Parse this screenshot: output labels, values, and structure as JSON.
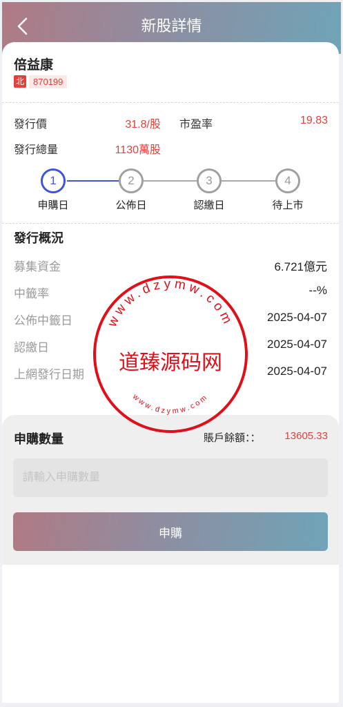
{
  "header": {
    "title": "新股詳情"
  },
  "stock": {
    "name": "倍益康",
    "market_badge": "北",
    "code": "870199"
  },
  "issue": {
    "price_label": "發行價",
    "price_value": "31.8/股",
    "pe_label": "市盈率",
    "pe_value": "19.83",
    "volume_label": "發行總量",
    "volume_value": "1130萬股"
  },
  "steps": [
    {
      "number": "1",
      "label": "申購日",
      "active": true
    },
    {
      "number": "2",
      "label": "公佈日",
      "active": false
    },
    {
      "number": "3",
      "label": "認繳日",
      "active": false
    },
    {
      "number": "4",
      "label": "待上市",
      "active": false
    }
  ],
  "overview": {
    "title": "發行概況",
    "rows": [
      {
        "label": "募集資金",
        "value": "6.721億元"
      },
      {
        "label": "中籤率",
        "value": "--%"
      },
      {
        "label": "公佈中籤日",
        "value": "2025-04-07"
      },
      {
        "label": "認繳日",
        "value": "2025-04-07"
      },
      {
        "label": "上網發行日期",
        "value": "2025-04-07"
      }
    ]
  },
  "subscribe": {
    "title": "申購數量",
    "balance_label": "賬戶餘額：：",
    "balance_value": "13605.33",
    "input_value": "",
    "input_placeholder": "請輸入申購數量",
    "button_label": "申購"
  },
  "watermark": {
    "center_text": "道臻源码网",
    "ring_text": "www.dzymw.com",
    "color": "#e0101a"
  },
  "colors": {
    "accent_red": "#e0413a",
    "step_active": "#3d55d6",
    "gradient_start": "#b07a84",
    "gradient_end": "#6fa4b8"
  }
}
